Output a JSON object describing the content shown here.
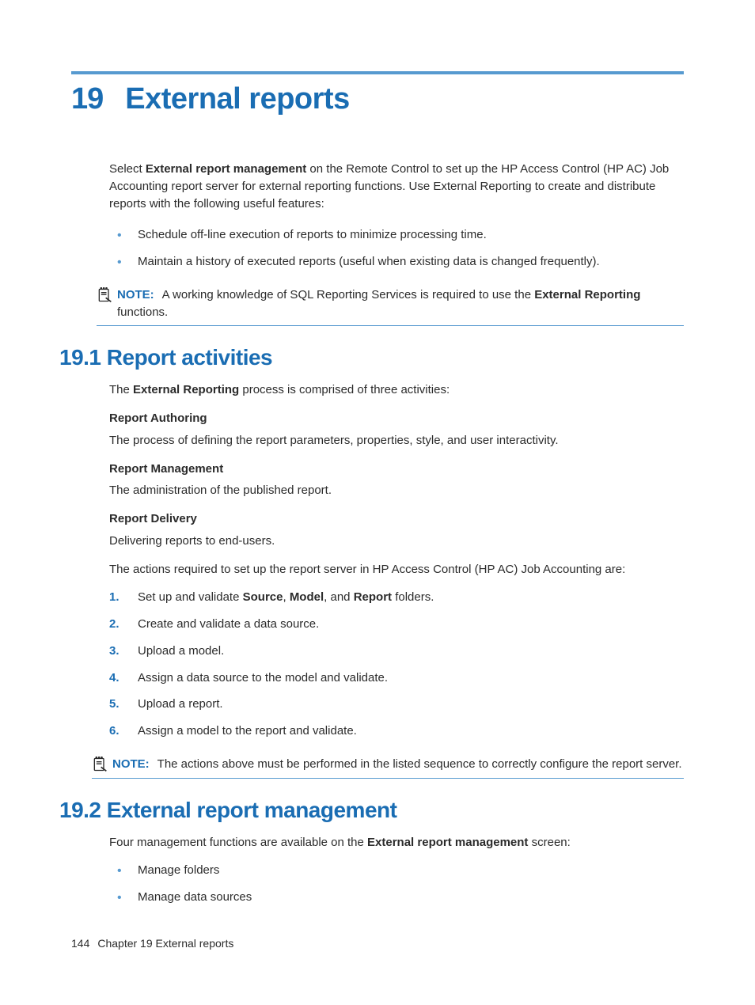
{
  "chapter": {
    "number": "19",
    "title": "External reports"
  },
  "intro": {
    "p1_a": "Select ",
    "p1_b": "External report management",
    "p1_c": " on the Remote Control to set up the HP Access Control (HP AC) Job Accounting report server for external reporting functions. Use External Reporting to create and distribute reports with the following useful features:",
    "bullets": [
      "Schedule off-line execution of reports to minimize processing time.",
      "Maintain a history of executed reports (useful when existing data is changed frequently)."
    ],
    "note_label": "NOTE:",
    "note_a": "A working knowledge of SQL Reporting Services is required to use the ",
    "note_b": "External Reporting",
    "note_c": " functions."
  },
  "s191": {
    "heading": "19.1 Report activities",
    "p1_a": "The ",
    "p1_b": "External Reporting",
    "p1_c": " process is comprised of three activities:",
    "ra_h": "Report Authoring",
    "ra_p": "The process of defining the report parameters, properties, style, and user interactivity.",
    "rm_h": "Report Management",
    "rm_p": "The administration of the published report.",
    "rd_h": "Report Delivery",
    "rd_p": "Delivering reports to end-users.",
    "actions_intro": "The actions required to set up the report server in HP Access Control (HP AC) Job Accounting are:",
    "steps": [
      {
        "n": "1.",
        "a": "Set up and validate ",
        "b": "Source",
        "c": ", ",
        "d": "Model",
        "e": ", and ",
        "f": "Report",
        "g": " folders."
      },
      {
        "n": "2.",
        "a": "Create and validate a data source."
      },
      {
        "n": "3.",
        "a": "Upload a model."
      },
      {
        "n": "4.",
        "a": "Assign a data source to the model and validate."
      },
      {
        "n": "5.",
        "a": "Upload a report."
      },
      {
        "n": "6.",
        "a": "Assign a model to the report and validate."
      }
    ],
    "note_label": "NOTE:",
    "note_text": "The actions above must be performed in the listed sequence to correctly configure the report server."
  },
  "s192": {
    "heading": "19.2 External report management",
    "p1_a": "Four management functions are available on the ",
    "p1_b": "External report management",
    "p1_c": " screen:",
    "bullets": [
      "Manage folders",
      "Manage data sources"
    ]
  },
  "footer": {
    "page": "144",
    "label": "Chapter 19   External reports"
  }
}
